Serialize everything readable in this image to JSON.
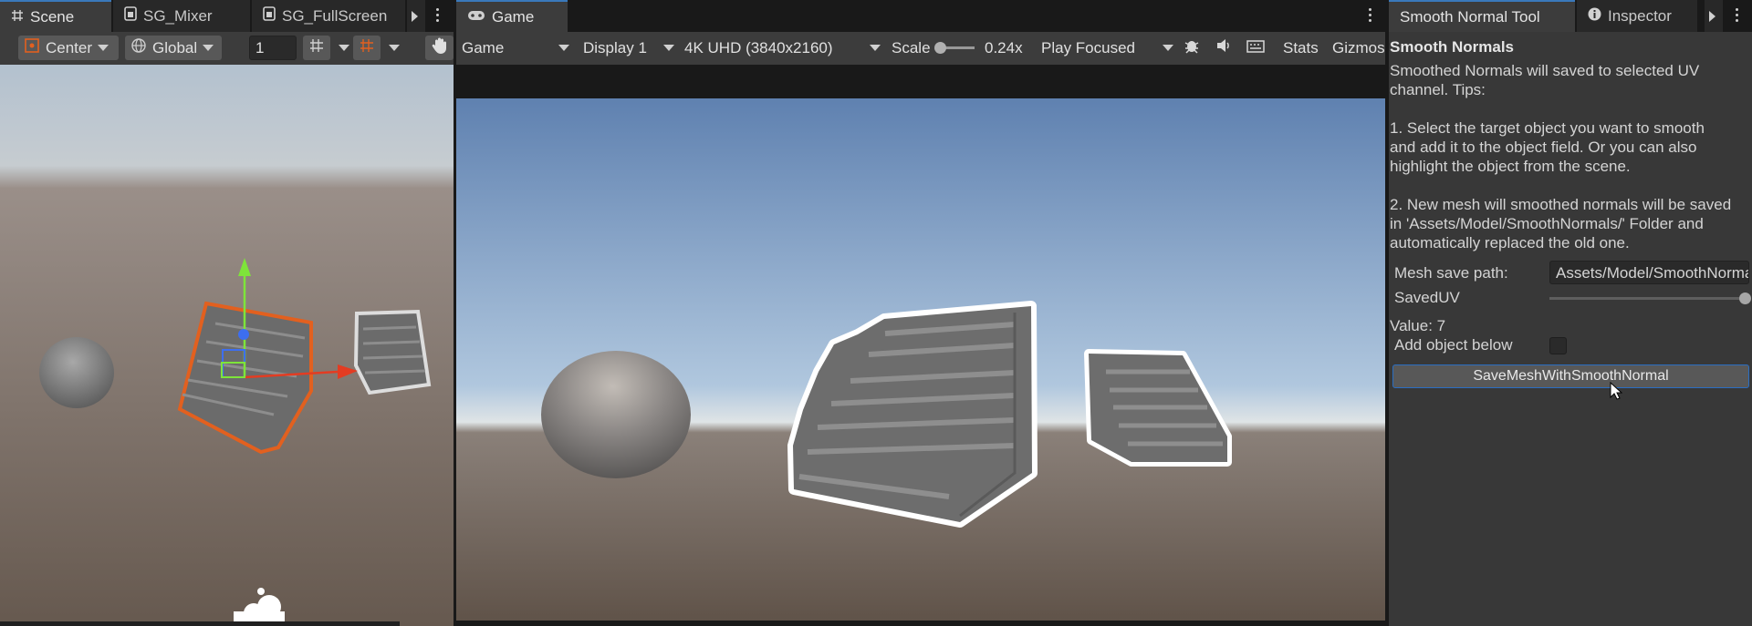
{
  "scene_panel": {
    "tabs": [
      {
        "label": "Scene",
        "icon": "grid-icon"
      },
      {
        "label": "SG_Mixer",
        "icon": "shadergraph-icon"
      },
      {
        "label": "SG_FullScreen",
        "icon": "shadergraph-icon"
      }
    ],
    "toolbar": {
      "pivot_mode": "Center",
      "pivot_rotation": "Global",
      "grid_size_value": "1"
    }
  },
  "game_panel": {
    "tab_label": "Game",
    "toolbar": {
      "view_mode": "Game",
      "display": "Display 1",
      "resolution": "4K UHD (3840x2160)",
      "scale_label": "Scale",
      "scale_value": "0.24x",
      "play_mode": "Play Focused",
      "stats_label": "Stats",
      "gizmos_label": "Gizmos"
    }
  },
  "inspector_panel": {
    "tabs": [
      {
        "label": "Smooth Normal Tool",
        "active": true
      },
      {
        "label": "Inspector",
        "icon": "info-icon",
        "active": false
      }
    ],
    "header": "Smooth Normals",
    "description_lines": [
      "Smoothed Normals will saved to selected UV",
      "channel. Tips:",
      "",
      "1. Select the target object you want to smooth",
      "and add it to the object field. Or you can also",
      "highlight the object from the scene.",
      "",
      "2. New mesh will smoothed normals will be saved",
      "in 'Assets/Model/SmoothNormals/' Folder and",
      "automatically replaced the old one."
    ],
    "mesh_save_path_label": "Mesh save path:",
    "mesh_save_path_value": "Assets/Model/SmoothNormals/",
    "saved_uv_label": "SavedUV",
    "saved_uv_value": 7,
    "saved_uv_max": 7,
    "value_text": "Value: 7",
    "add_object_below_label": "Add object below",
    "add_object_below_checked": false,
    "save_button_label": "SaveMeshWithSmoothNormal"
  },
  "colors": {
    "selection_outline": "#e2601f",
    "game_outline": "#ffffff",
    "accent_blue": "#3a79bb",
    "gizmo_x": "#e33c22",
    "gizmo_y": "#7ee43a",
    "gizmo_z": "#3d6ef0"
  }
}
